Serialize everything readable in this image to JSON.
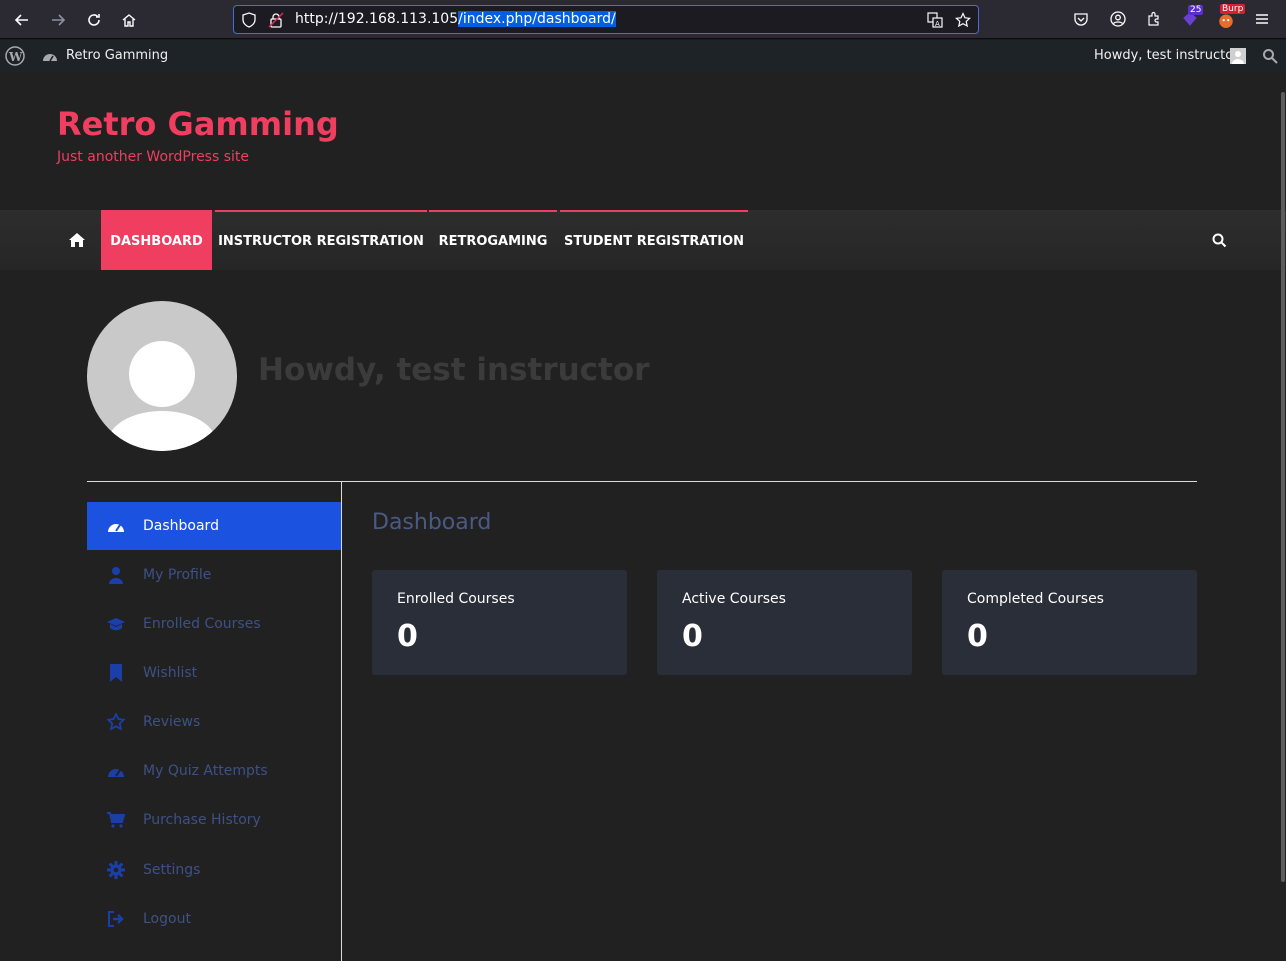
{
  "browser": {
    "url_prefix": "http://192.168.113.105",
    "url_path": "/index.php/dashboard/",
    "extension_badge": "25",
    "burp_badge": "Burp"
  },
  "admin_bar": {
    "site_name": "Retro Gamming",
    "greeting": "Howdy, test instructor"
  },
  "site": {
    "title": "Retro Gamming",
    "tagline": "Just another WordPress site"
  },
  "nav": {
    "items": [
      {
        "label": "DASHBOARD"
      },
      {
        "label": "INSTRUCTOR REGISTRATION"
      },
      {
        "label": "RETROGAMING"
      },
      {
        "label": "STUDENT REGISTRATION"
      }
    ]
  },
  "profile": {
    "greeting": "Howdy, test instructor"
  },
  "sidebar": {
    "items": [
      {
        "label": "Dashboard",
        "icon": "dashboard-icon"
      },
      {
        "label": "My Profile",
        "icon": "user-icon"
      },
      {
        "label": "Enrolled Courses",
        "icon": "graduation-cap-icon"
      },
      {
        "label": "Wishlist",
        "icon": "bookmark-icon"
      },
      {
        "label": "Reviews",
        "icon": "star-icon"
      },
      {
        "label": "My Quiz Attempts",
        "icon": "gauge-icon"
      },
      {
        "label": "Purchase History",
        "icon": "cart-icon"
      },
      {
        "label": "Settings",
        "icon": "gear-icon"
      },
      {
        "label": "Logout",
        "icon": "logout-icon"
      }
    ]
  },
  "dashboard": {
    "title": "Dashboard",
    "cards": [
      {
        "label": "Enrolled Courses",
        "value": "0"
      },
      {
        "label": "Active Courses",
        "value": "0"
      },
      {
        "label": "Completed Courses",
        "value": "0"
      }
    ]
  },
  "colors": {
    "brand": "#ef3e5f",
    "sidebar_active": "#1b53e0",
    "sidebar_text": "#3e5186",
    "card_bg": "#2a2e38"
  }
}
